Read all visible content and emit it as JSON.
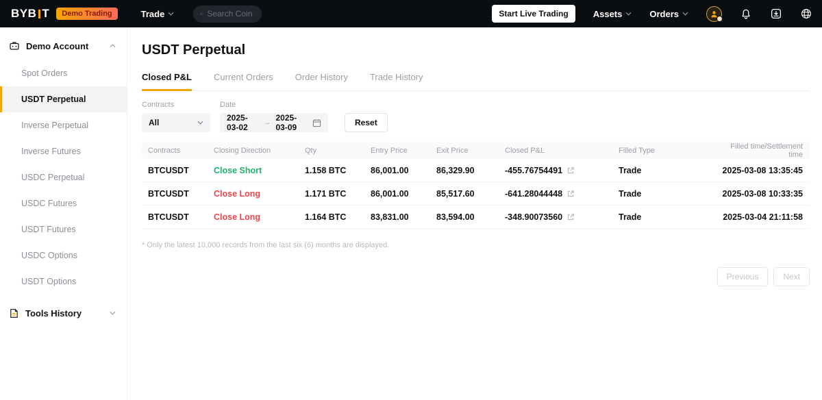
{
  "topbar": {
    "logo_byb": "BYB",
    "logo_t": "T",
    "badge": "Demo Trading",
    "trade_label": "Trade",
    "search_placeholder": "Search Coin",
    "start_live_label": "Start Live Trading",
    "assets_label": "Assets",
    "orders_label": "Orders"
  },
  "sidebar": {
    "account_label": "Demo Account",
    "items": [
      "Spot Orders",
      "USDT Perpetual",
      "Inverse Perpetual",
      "Inverse Futures",
      "USDC Perpetual",
      "USDC Futures",
      "USDT Futures",
      "USDC Options",
      "USDT Options"
    ],
    "tools_label": "Tools History"
  },
  "main": {
    "title": "USDT Perpetual",
    "tabs": [
      "Closed P&L",
      "Current Orders",
      "Order History",
      "Trade History"
    ],
    "filters": {
      "contracts_label": "Contracts",
      "contracts_value": "All",
      "date_label": "Date",
      "date_from": "2025-03-02",
      "date_arrow": "→",
      "date_to": "2025-03-09",
      "reset_label": "Reset"
    },
    "table": {
      "headers": [
        "Contracts",
        "Closing Direction",
        "Qty",
        "Entry Price",
        "Exit Price",
        "Closed P&L",
        "Filled Type",
        "Filled time/Settlement time"
      ],
      "rows": [
        {
          "contracts": "BTCUSDT",
          "direction": "Close Short",
          "direction_class": "dir green",
          "qty": "1.158 BTC",
          "entry_price": "86,001.00",
          "exit_price": "86,329.90",
          "closed_pnl": "-455.76754491",
          "filled_type": "Trade",
          "filled_time": "2025-03-08 13:35:45"
        },
        {
          "contracts": "BTCUSDT",
          "direction": "Close Long",
          "direction_class": "dir red",
          "qty": "1.171 BTC",
          "entry_price": "86,001.00",
          "exit_price": "85,517.60",
          "closed_pnl": "-641.28044448",
          "filled_type": "Trade",
          "filled_time": "2025-03-08 10:33:35"
        },
        {
          "contracts": "BTCUSDT",
          "direction": "Close Long",
          "direction_class": "dir red",
          "qty": "1.164 BTC",
          "entry_price": "83,831.00",
          "exit_price": "83,594.00",
          "closed_pnl": "-348.90073560",
          "filled_type": "Trade",
          "filled_time": "2025-03-04 21:11:58"
        }
      ]
    },
    "note": "* Only the latest 10,000 records from the last six (6) months are displayed.",
    "pagination": {
      "previous_label": "Previous",
      "next_label": "Next"
    }
  },
  "colors": {
    "accent": "#f7a600",
    "green": "#20b26c",
    "red": "#ef454a",
    "topbar_bg": "#0b0e11"
  }
}
